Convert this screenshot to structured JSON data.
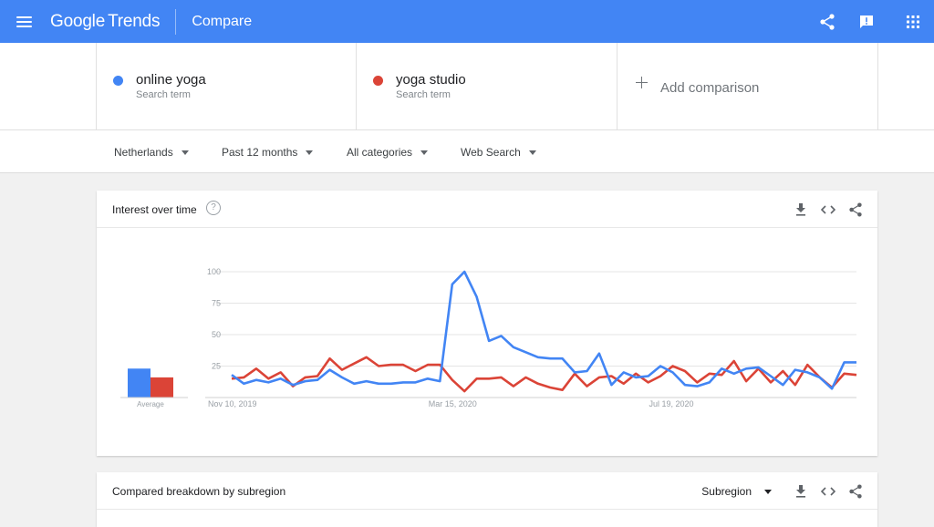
{
  "header": {
    "logo_google": "Google",
    "logo_trends": "Trends",
    "title": "Compare",
    "icons": [
      "menu-icon",
      "share-icon",
      "feedback-icon",
      "apps-icon"
    ]
  },
  "terms": [
    {
      "name": "online yoga",
      "sub": "Search term",
      "color": "#4285f4"
    },
    {
      "name": "yoga studio",
      "sub": "Search term",
      "color": "#db4437"
    }
  ],
  "add_comparison": "Add comparison",
  "filters": {
    "region": "Netherlands",
    "period": "Past 12 months",
    "category": "All categories",
    "search_type": "Web Search"
  },
  "interest_card": {
    "title": "Interest over time",
    "help": "?"
  },
  "breakdown_card": {
    "title": "Compared breakdown by subregion",
    "select": "Subregion"
  },
  "chart_data": {
    "type": "line",
    "title": "Interest over time",
    "ylim": [
      0,
      100
    ],
    "y_ticks": [
      "100",
      "75",
      "50",
      "25"
    ],
    "x_tick_labels": [
      "Nov 10, 2019",
      "Mar 15, 2020",
      "Jul 19, 2020"
    ],
    "x_tick_index": [
      0,
      18,
      36
    ],
    "grid": true,
    "average_label": "Average",
    "average_values": [
      23,
      16
    ],
    "series": [
      {
        "name": "online yoga",
        "color": "#4285f4",
        "values": [
          18,
          11,
          14,
          12,
          15,
          10,
          13,
          14,
          22,
          16,
          11,
          13,
          11,
          11,
          12,
          12,
          15,
          13,
          90,
          100,
          80,
          45,
          49,
          40,
          36,
          32,
          31,
          31,
          20,
          21,
          35,
          10,
          20,
          16,
          17,
          25,
          20,
          10,
          9,
          12,
          23,
          19,
          23,
          24,
          17,
          10,
          22,
          20,
          16,
          7,
          28,
          28
        ]
      },
      {
        "name": "yoga studio",
        "color": "#db4437",
        "values": [
          15,
          16,
          23,
          15,
          20,
          9,
          16,
          17,
          31,
          22,
          27,
          32,
          25,
          26,
          26,
          21,
          26,
          26,
          14,
          5,
          15,
          15,
          16,
          9,
          16,
          11,
          8,
          6,
          19,
          9,
          16,
          17,
          11,
          19,
          12,
          17,
          25,
          21,
          12,
          19,
          18,
          29,
          13,
          23,
          12,
          21,
          10,
          26,
          16,
          8,
          19,
          18
        ]
      }
    ]
  }
}
